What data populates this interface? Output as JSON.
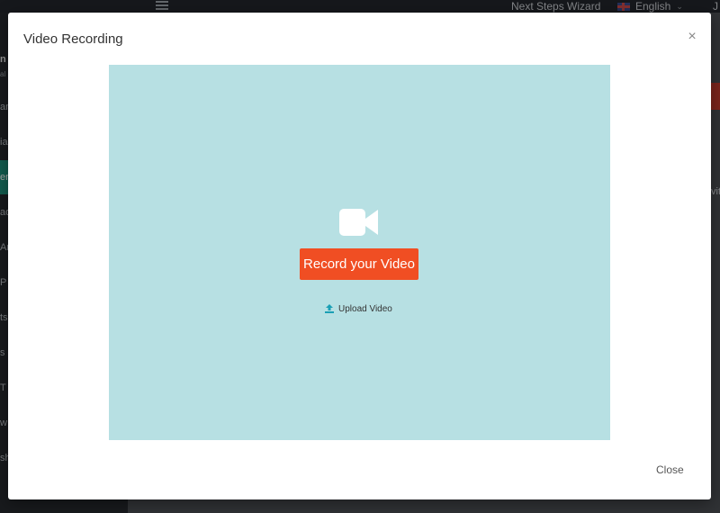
{
  "topbar": {
    "wizard_label": "Next Steps Wizard",
    "language_label": "English",
    "user_initial": "J"
  },
  "sidebar": {
    "header_line1": "n",
    "header_line2": "al",
    "items": [
      {
        "label": "an"
      },
      {
        "label": "ia"
      },
      {
        "label": "en",
        "active": true
      },
      {
        "label": "ad"
      },
      {
        "label": "Ar"
      },
      {
        "label": "P"
      },
      {
        "label": "ts"
      },
      {
        "label": "s"
      },
      {
        "label": "T"
      },
      {
        "label": "w"
      },
      {
        "label": "sh"
      }
    ]
  },
  "background": {
    "fragment_right": "vit"
  },
  "modal": {
    "title": "Video Recording",
    "close_glyph": "×",
    "record_button_label": "Record your Video",
    "upload_label": "Upload Video",
    "footer_close_label": "Close"
  },
  "colors": {
    "accent": "#f04e23",
    "video_bg": "#b7e0e3",
    "upload_icon": "#1a9fb5",
    "sidebar_active": "#1e8f7a"
  },
  "icons": {
    "camera": "video-camera-icon",
    "upload": "upload-icon",
    "flag": "uk-flag-icon"
  }
}
